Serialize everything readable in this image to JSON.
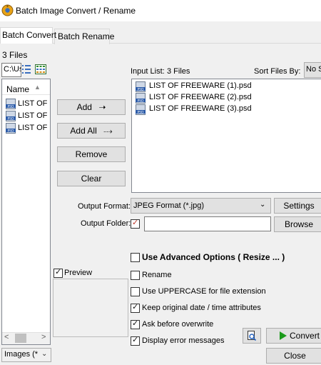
{
  "window": {
    "title": "Batch Image Convert / Rename"
  },
  "tabs": [
    {
      "label": "Batch Convert",
      "active": true
    },
    {
      "label": "Batch Rename",
      "active": false
    }
  ],
  "left_pane": {
    "files_count": "3 Files",
    "path": "C:\\Us",
    "column_header": "Name",
    "items": [
      "LIST OF F",
      "LIST OF F",
      "LIST OF F"
    ],
    "filter_select": "Images (*"
  },
  "buttons": {
    "add": "Add",
    "add_all": "Add All",
    "remove": "Remove",
    "clear": "Clear",
    "settings": "Settings",
    "browse": "Browse",
    "convert": "Convert",
    "close": "Close"
  },
  "input_list": {
    "label": "Input List:",
    "count": "3 Files",
    "sort_label": "Sort Files By:",
    "sort_value": "No S",
    "items": [
      "LIST OF FREEWARE (1).psd",
      "LIST OF FREEWARE (2).psd",
      "LIST OF FREEWARE (3).psd"
    ]
  },
  "output": {
    "format_label": "Output Format:",
    "format_value": "JPEG Format (*.jpg)",
    "folder_label": "Output Folder:",
    "folder_checked": true,
    "folder_value": ""
  },
  "options": {
    "preview": {
      "label": "Preview",
      "checked": true
    },
    "advanced": {
      "label": "Use Advanced Options ( Resize ... )",
      "checked": false
    },
    "rename": {
      "label": "Rename",
      "checked": false
    },
    "uppercase": {
      "label": "Use UPPERCASE for file extension",
      "checked": false
    },
    "keep_date": {
      "label": "Keep original date / time attributes",
      "checked": true
    },
    "ask_overwrite": {
      "label": "Ask before overwrite",
      "checked": true
    },
    "display_errors": {
      "label": "Display error messages",
      "checked": true
    }
  },
  "colors": {
    "accent_green": "#1a9a1a",
    "window_bg": "#f0f0f0",
    "button_bg": "#e1e1e1"
  },
  "icons": [
    "app-icon",
    "psd-file-icon",
    "list-view-icon",
    "grid-view-icon",
    "arrow-right-icon",
    "double-arrow-right-icon",
    "preview-magnifier-icon",
    "play-icon",
    "chevron-down-icon",
    "sort-up-icon"
  ]
}
